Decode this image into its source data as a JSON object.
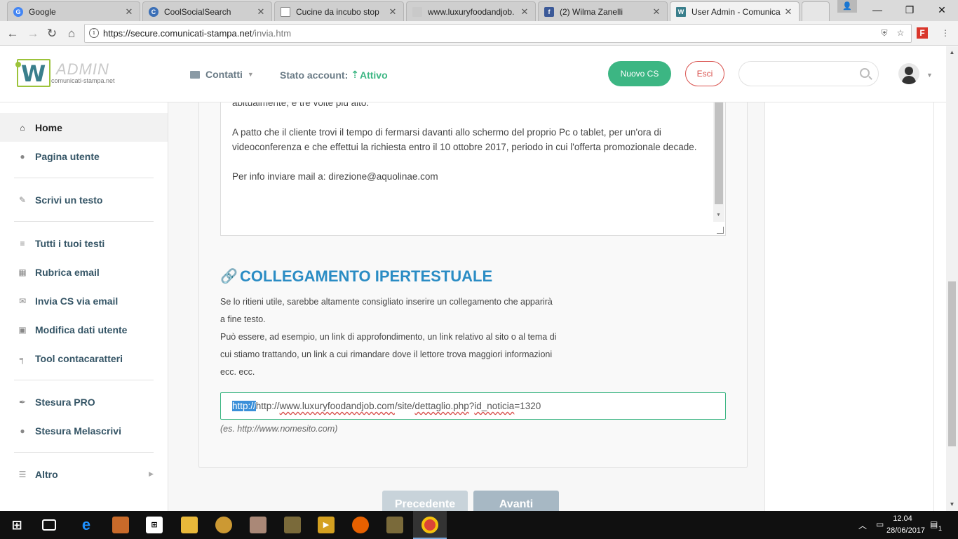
{
  "browser": {
    "tabs": [
      {
        "title": "Google",
        "fav": "G",
        "color": "#4285f4"
      },
      {
        "title": "CoolSocialSearch",
        "fav": "C",
        "color": "#3b6fb6"
      },
      {
        "title": "Cucine da incubo stop",
        "fav": "",
        "color": "#888888"
      },
      {
        "title": "www.luxuryfoodandjob.",
        "fav": "",
        "color": "#aaaaaa"
      },
      {
        "title": "(2) Wilma Zanelli",
        "fav": "f",
        "color": "#3b5998"
      },
      {
        "title": "User Admin - Comunica",
        "fav": "W",
        "color": "#3a7f8c"
      }
    ],
    "url_host": "https://secure.comunicati-stampa.net",
    "url_path": "/invia.htm"
  },
  "header": {
    "logo_admin": "ADMIN",
    "logo_sub": "comunicati-stampa.net",
    "contacts": "Contatti",
    "account_label": "Stato account:",
    "account_status": "Attivo",
    "new_button": "Nuovo CS",
    "exit_button": "Esci",
    "search_placeholder": ""
  },
  "sidebar": {
    "items": [
      {
        "label": "Home",
        "icon": "home-icon"
      },
      {
        "label": "Pagina utente",
        "icon": "user-icon"
      },
      {
        "label": "Scrivi un testo",
        "icon": "edit-icon"
      },
      {
        "label": "Tutti i tuoi testi",
        "icon": "database-icon"
      },
      {
        "label": "Rubrica email",
        "icon": "address-book-icon"
      },
      {
        "label": "Invia CS via email",
        "icon": "envelope-icon"
      },
      {
        "label": "Modifica dati utente",
        "icon": "pencil-square-icon"
      },
      {
        "label": "Tool contacaratteri",
        "icon": "tool-icon"
      },
      {
        "label": "Stesura PRO",
        "icon": "feather-icon"
      },
      {
        "label": "Stesura Melascrivi",
        "icon": "apple-icon"
      },
      {
        "label": "Altro",
        "icon": "menu-icon"
      }
    ]
  },
  "main": {
    "textarea_lines": [
      "abitualmente, è tre volte più alto.",
      "",
      "A patto che il cliente trovi il tempo di fermarsi davanti allo schermo del proprio Pc o tablet, per un'ora di videoconferenza e che effettui la richiesta entro il 10 ottobre 2017, periodo in cui l'offerta promozionale decade.",
      "",
      "Per info inviare mail a: direzione@aquolinae.com"
    ],
    "link_section_title": "COLLEGAMENTO IPERTESTUALE",
    "link_desc_1": "Se lo ritieni utile, sarebbe altamente consigliato inserire un collegamento che apparirà a fine testo.",
    "link_desc_2": "Può essere, ad esempio, un link di approfondimento, un link relativo al sito o al tema di cui stiamo trattando, un link a cui rimandare dove il lettore trova maggiori informazioni ecc. ecc.",
    "link_value_selected": "http://",
    "link_value_pre": "http://",
    "link_value_domain": "www.luxuryfoodandjob.com",
    "link_value_mid": "/site/",
    "link_value_page": "dettaglio.php",
    "link_value_q": "?",
    "link_value_param": "id_noticia",
    "link_value_end": "=1320",
    "link_hint": "(es. http://www.nomesito.com)",
    "prev_button": "Precedente",
    "next_button": "Avanti"
  },
  "taskbar": {
    "time": "12.04",
    "date": "28/06/2017",
    "notifications": "1"
  }
}
